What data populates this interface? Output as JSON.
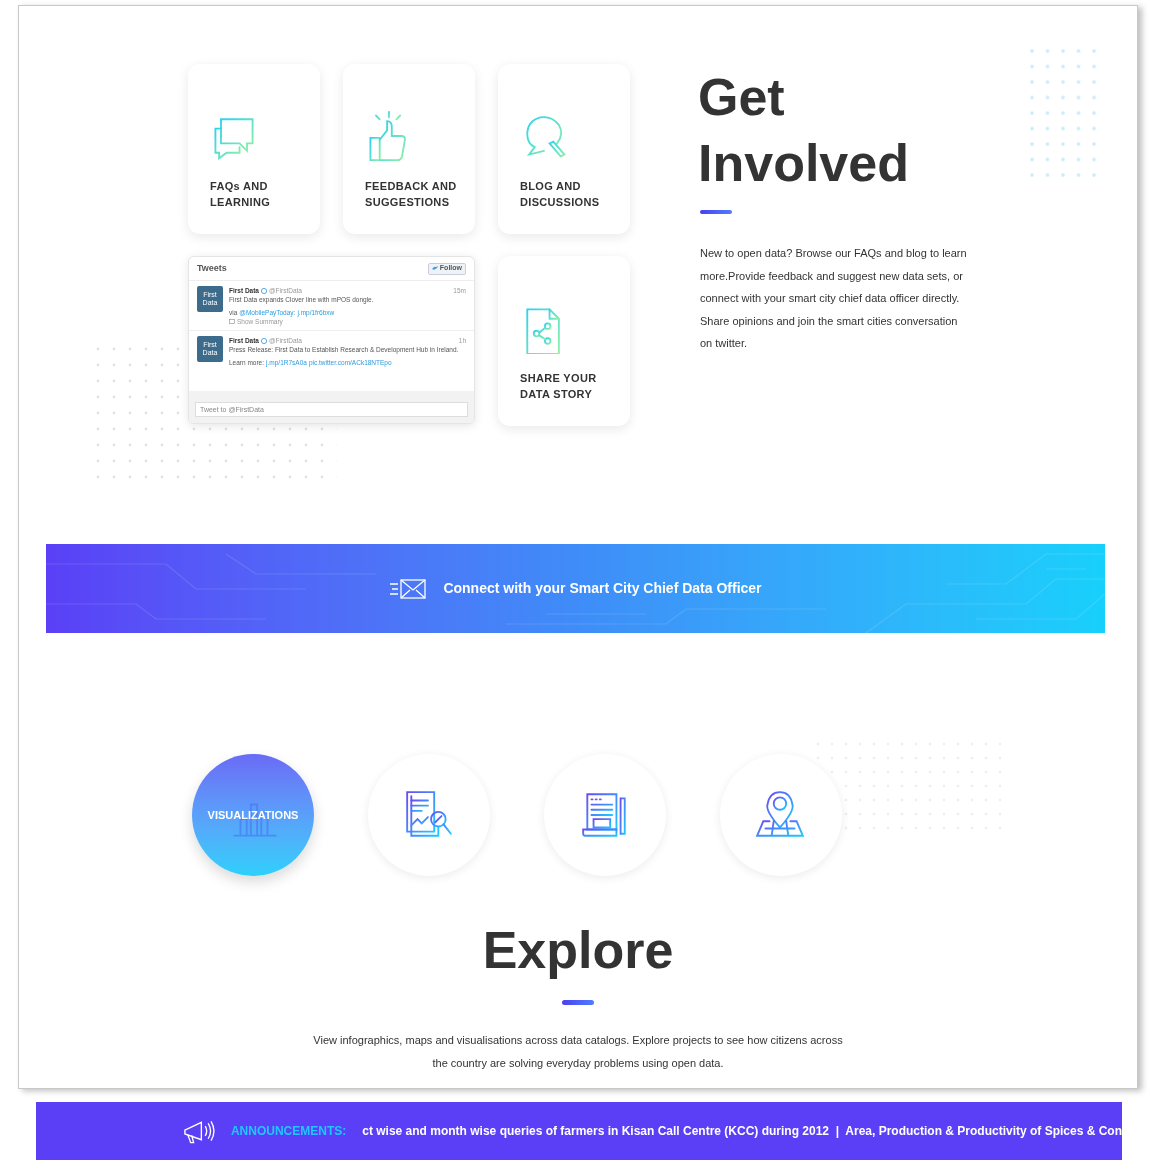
{
  "get_involved": {
    "cards": [
      {
        "kind": "chat",
        "label": "FAQs AND LEARNING"
      },
      {
        "kind": "thumb",
        "label": "FEEDBACK AND SUGGESTIONS"
      },
      {
        "kind": "comment",
        "label": "BLOG AND DISCUSSIONS"
      },
      {
        "kind": "share",
        "label": "SHARE YOUR DATA STORY"
      }
    ],
    "tweets_widget": {
      "title": "Tweets",
      "follow": "Follow",
      "tweets": [
        {
          "avatar": "First Data",
          "name": "First Data",
          "handle": "@FirstData",
          "time": "15m",
          "text": "First Data expands Clover line with mPOS dongle.",
          "link_prefix": "via",
          "links": [
            "@MobilePayToday:",
            "j.mp/1fr6bxw"
          ],
          "extra": "Show Summary"
        },
        {
          "avatar": "First Data",
          "name": "First Data",
          "handle": "@FirstData",
          "time": "1h",
          "text": "Press Release: First Data to Establish Research & Development Hub in Ireland.",
          "link_prefix": "Learn more:",
          "links": [
            "j.mp/1R7sA0a",
            "pic.twitter.com/ACk18NTEpo"
          ]
        }
      ],
      "compose_placeholder": "Tweet to @FirstData"
    },
    "title_lines": [
      "Get",
      "Involved"
    ],
    "text": "New to open data? Browse our FAQs and blog to learn more.Provide feedback and suggest new data sets, or connect with your smart city chief data officer directly.  Share opinions and join the smart cities conversation on twitter."
  },
  "banner": {
    "text": "Connect with your Smart City Chief Data Officer"
  },
  "explore": {
    "items": [
      {
        "kind": "chart",
        "label": "VISUALIZATIONS",
        "selected": true
      },
      {
        "kind": "report",
        "selected": false
      },
      {
        "kind": "document",
        "selected": false
      },
      {
        "kind": "map",
        "selected": false
      }
    ],
    "title": "Explore",
    "text": "View infographics, maps and visualisations across data catalogs. Explore projects to see how citizens across the country are solving everyday problems using open data."
  },
  "announcements": {
    "label": "ANNOUNCEMENTS:",
    "ticker": "ct wise and month wise queries of farmers in Kisan Call Centre (KCC) during 2012  |  Area, Production & Productivity of Spices & Con"
  }
}
